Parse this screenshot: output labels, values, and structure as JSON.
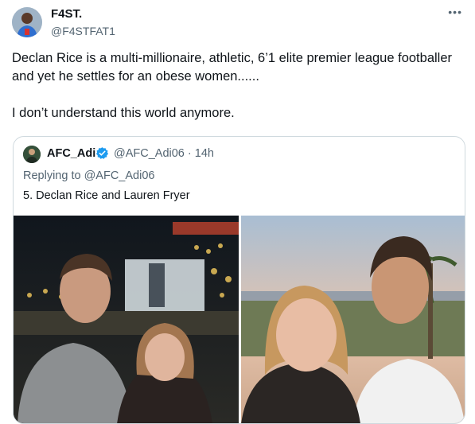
{
  "author": {
    "name": "F4ST.",
    "handle": "@F4STFAT1"
  },
  "more_icon": "more-options-icon",
  "tweet": {
    "line1": "Declan Rice is a multi-millionaire, athletic, 6’1 elite premier league footballer and yet he settles for an obese women......",
    "line2": "I don’t understand this world anymore."
  },
  "quote": {
    "name": "AFC_Adi",
    "handle_time": "@AFC_Adi06 · 14h",
    "replying_prefix": "Replying to ",
    "replying_handle": "@AFC_Adi06",
    "text": "5. Declan Rice and Lauren Fryer",
    "verified_icon": "verified-badge-icon",
    "verified_color": "#1d9bf0"
  },
  "photos": [
    "photo-night-stadium",
    "photo-sunset-sea"
  ]
}
